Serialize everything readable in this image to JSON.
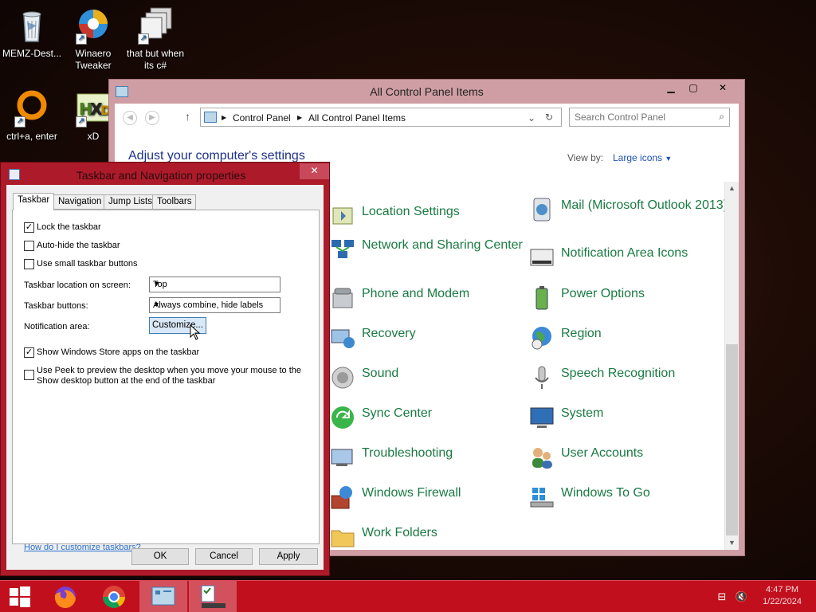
{
  "desktop": {
    "icons": [
      {
        "label": "MEMZ-Dest...",
        "icon": "recycle-bin-icon"
      },
      {
        "label": "Winaero Tweaker",
        "icon": "winaero-tweaker-icon"
      },
      {
        "label": "that but when its c#",
        "icon": "windows-stack-icon"
      },
      {
        "label": "ctrl+a, enter",
        "icon": "orange-ring-icon"
      },
      {
        "label": "xD",
        "icon": "hxd-icon"
      }
    ]
  },
  "control_panel": {
    "title": "All Control Panel Items",
    "minimize": "▁",
    "maximize": "▢",
    "close": "✕",
    "breadcrumb": [
      "Control Panel",
      "All Control Panel Items"
    ],
    "search_placeholder": "Search Control Panel",
    "heading": "Adjust your computer's settings",
    "view_by_label": "View by:",
    "view_by_value": "Large icons",
    "items_left": [
      "Location Settings",
      "Network and Sharing Center",
      "Phone and Modem",
      "Recovery",
      "Sound",
      "Sync Center",
      "Troubleshooting",
      "Windows Firewall",
      "Work Folders"
    ],
    "items_right": [
      "Mail (Microsoft Outlook 2013)",
      "Notification Area Icons",
      "Power Options",
      "Region",
      "Speech Recognition",
      "System",
      "User Accounts",
      "Windows To Go"
    ]
  },
  "dialog": {
    "title": "Taskbar and Navigation properties",
    "close": "✕",
    "tabs": [
      "Taskbar",
      "Navigation",
      "Jump Lists",
      "Toolbars"
    ],
    "lock_taskbar": "Lock the taskbar",
    "auto_hide": "Auto-hide the taskbar",
    "small_buttons": "Use small taskbar buttons",
    "location_label": "Taskbar location on screen:",
    "location_value": "Top",
    "buttons_label": "Taskbar buttons:",
    "buttons_value": "Always combine, hide labels",
    "notification_label": "Notification area:",
    "customize": "Customize...",
    "store_apps": "Show Windows Store apps on the taskbar",
    "peek_line1": "Use Peek to preview the desktop when you move your mouse to the",
    "peek_line2": "Show desktop button at the end of the taskbar",
    "help_link": "How do I customize taskbars?",
    "ok": "OK",
    "cancel": "Cancel",
    "apply": "Apply",
    "checked": {
      "lock": true,
      "autohide": false,
      "small": false,
      "store": true,
      "peek": false
    }
  },
  "taskbar": {
    "clock_time": "4:47 PM",
    "clock_date": "1/22/2024"
  },
  "colors": {
    "window_frame": "#cf9ea4",
    "dialog_frame": "#ad1a2a",
    "taskbar": "#c10f1e",
    "item_text": "#1a7a42",
    "heading_text": "#1e3287"
  }
}
